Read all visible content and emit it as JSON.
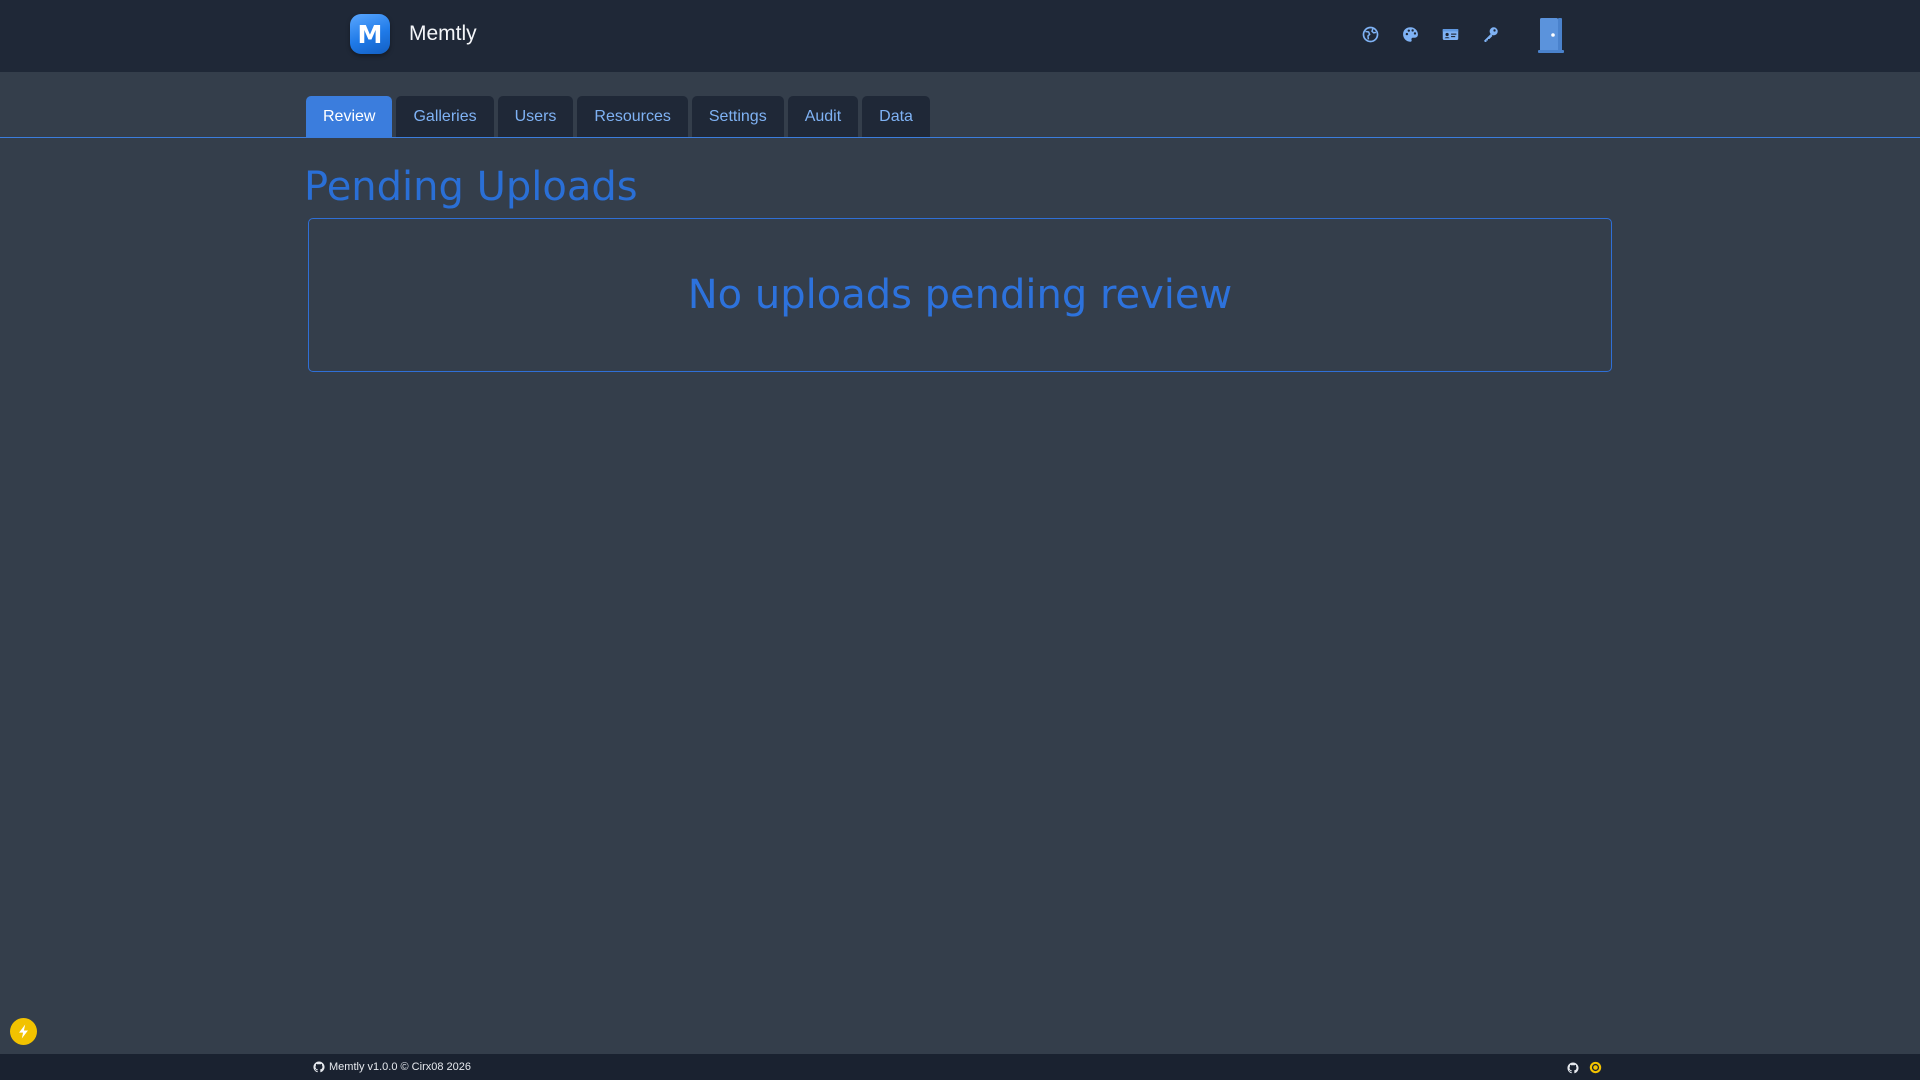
{
  "header": {
    "app_name": "Memtly",
    "logo_letter": "M",
    "icons": [
      "globe-icon",
      "palette-icon",
      "id-card-icon",
      "key-icon",
      "logout-door-icon"
    ]
  },
  "tabs": [
    {
      "label": "Review",
      "active": true
    },
    {
      "label": "Galleries",
      "active": false
    },
    {
      "label": "Users",
      "active": false
    },
    {
      "label": "Resources",
      "active": false
    },
    {
      "label": "Settings",
      "active": false
    },
    {
      "label": "Audit",
      "active": false
    },
    {
      "label": "Data",
      "active": false
    }
  ],
  "main": {
    "title": "Pending Uploads",
    "empty_message": "No uploads pending review"
  },
  "footer": {
    "text": "Memtly v1.0.0 © Cirx08 2026",
    "icons": [
      "github-icon",
      "coin-icon"
    ]
  },
  "colors": {
    "background": "#343e4b",
    "navbar": "#1f2837",
    "accent": "#3b7ddd",
    "heading": "#2a6fd6",
    "fab": "#f2c200"
  }
}
